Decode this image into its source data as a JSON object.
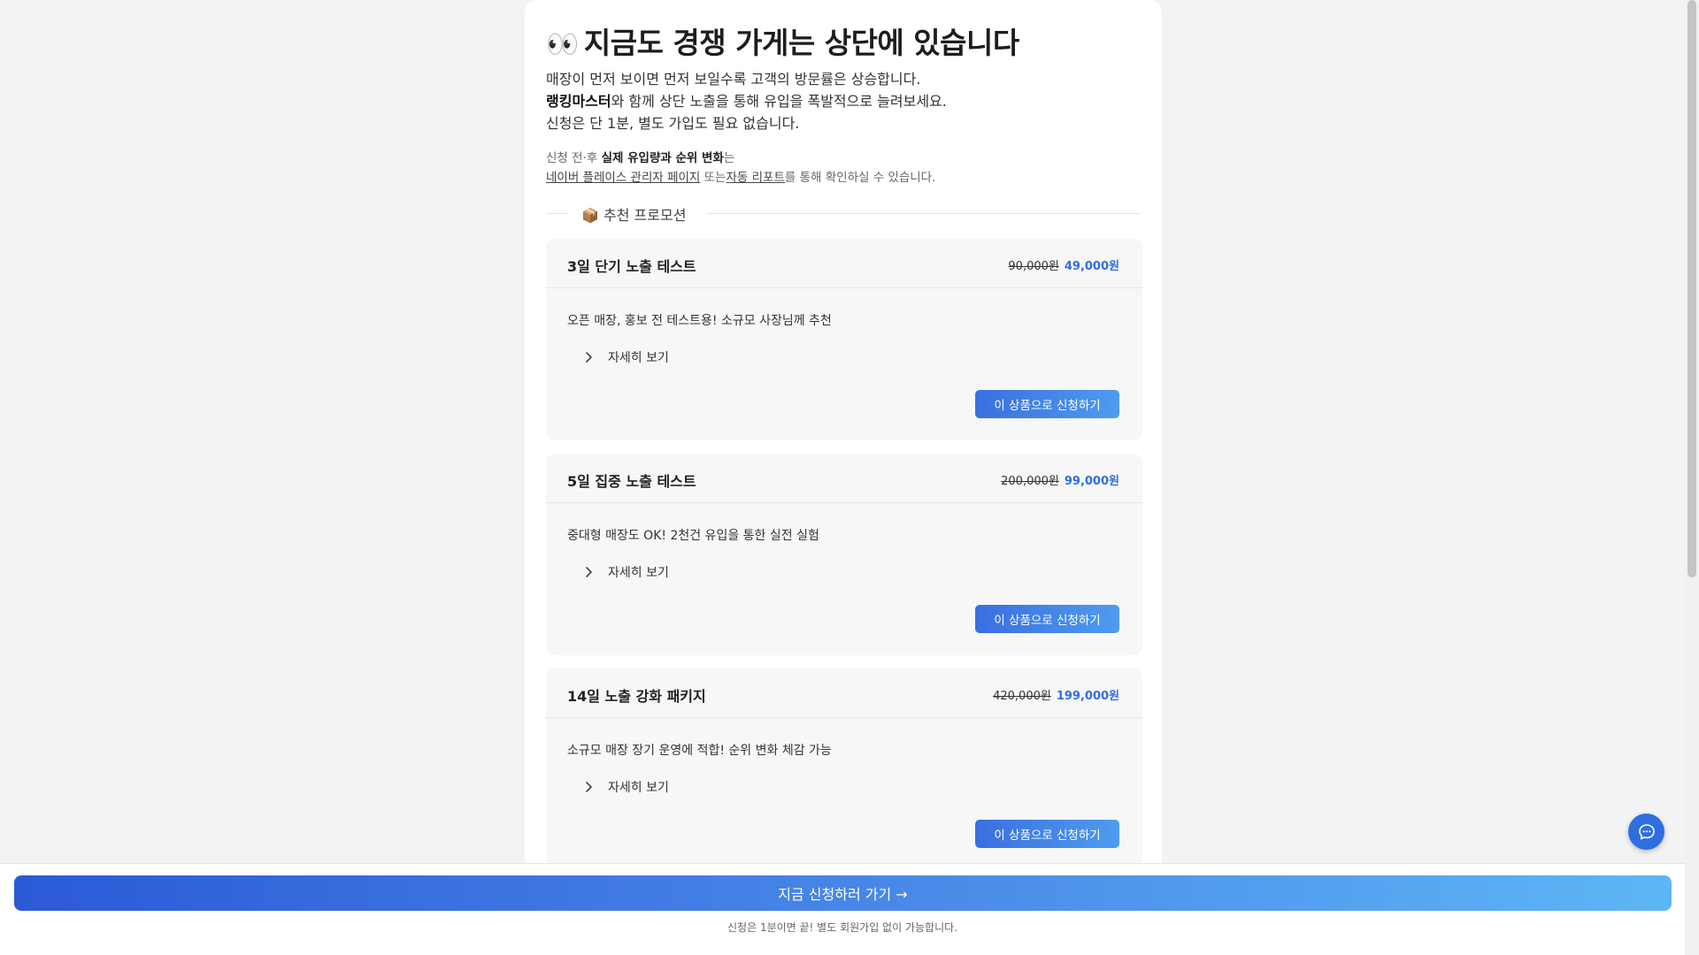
{
  "hero": {
    "eyes_emoji": "👀",
    "title": "지금도 경쟁 가게는 상단에 있습니다",
    "line1": "매장이 먼저 보이면 먼저 보일수록 고객의 방문률은 상승합니다.",
    "line2_bold": "랭킹마스터",
    "line2_rest": "와 함께 상단 노출을 통해 유입을 폭발적으로 늘려보세요.",
    "line3": "신청은 단 1분, 별도 가입도 필요 없습니다."
  },
  "note": {
    "prefix": "신청 전·후 ",
    "bold": "실제 유입량과 순위 변화",
    "suffix": "는",
    "link1": "네이버 플레이스 관리자 페이지",
    "mid": " 또는",
    "link2": "자동 리포트",
    "end": "를 통해 확인하실 수 있습니다."
  },
  "section": {
    "icon": "📦",
    "label": "추천 프로모션"
  },
  "cards": [
    {
      "title": "3일 단기 노출 테스트",
      "old_price": "90,000원",
      "new_price": "49,000원",
      "description": "오픈 매장, 홍보 전 테스트용! 소규모 사장님께 추천",
      "details_label": "자세히 보기",
      "button_label": "이 상품으로 신청하기"
    },
    {
      "title": "5일 집중 노출 테스트",
      "old_price": "200,000원",
      "new_price": "99,000원",
      "description": "중대형 매장도 OK! 2천건 유입을 통한 실전 실험",
      "details_label": "자세히 보기",
      "button_label": "이 상품으로 신청하기"
    },
    {
      "title": "14일 노출 강화 패키지",
      "old_price": "420,000원",
      "new_price": "199,000원",
      "description": "소규모 매장 장기 운영에 적합! 순위 변화 체감 가능",
      "details_label": "자세히 보기",
      "button_label": "이 상품으로 신청하기"
    }
  ],
  "bottom": {
    "cta_label": "지금 신청하러 가기 →",
    "sub_text": "신청은 1분이면 끝! 별도 회원가입 없이 가능합니다."
  },
  "colors": {
    "accent": "#2f6fdc",
    "cta_start": "#2c5ad6",
    "cta_end": "#5db6f5"
  },
  "icons": {
    "chat": "chat-bubble-icon",
    "chevron": "chevron-right-icon"
  }
}
